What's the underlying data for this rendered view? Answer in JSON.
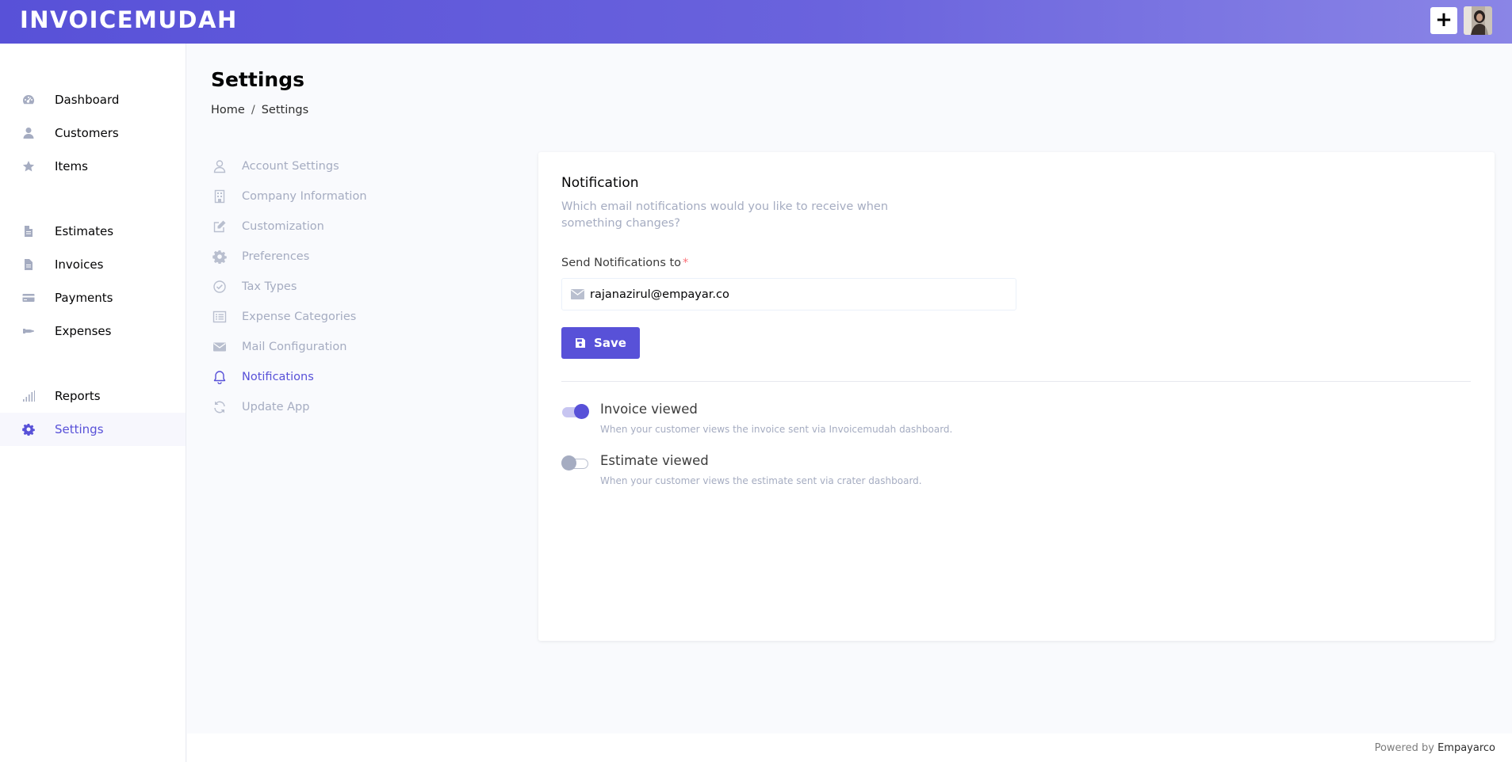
{
  "app": {
    "logo": "INVOICEMUDAH",
    "add_button": "+",
    "colors": {
      "primary": "#5851d8",
      "muted": "#a5acc1",
      "required": "#fb7178"
    }
  },
  "sidebar": {
    "items": [
      {
        "label": "Dashboard",
        "icon": "dashboard-gauge-icon"
      },
      {
        "label": "Customers",
        "icon": "user-icon"
      },
      {
        "label": "Items",
        "icon": "star-icon"
      },
      {
        "label": "Estimates",
        "icon": "document-icon"
      },
      {
        "label": "Invoices",
        "icon": "document-icon"
      },
      {
        "label": "Payments",
        "icon": "credit-card-icon"
      },
      {
        "label": "Expenses",
        "icon": "money-icon"
      },
      {
        "label": "Reports",
        "icon": "signal-bars-icon"
      },
      {
        "label": "Settings",
        "icon": "gear-icon",
        "active": true
      }
    ]
  },
  "page": {
    "title": "Settings",
    "breadcrumb": {
      "home": "Home",
      "separator": "/",
      "current": "Settings"
    }
  },
  "settings_menu": {
    "items": [
      {
        "label": "Account Settings",
        "icon": "user-outline-icon"
      },
      {
        "label": "Company Information",
        "icon": "building-icon"
      },
      {
        "label": "Customization",
        "icon": "edit-icon"
      },
      {
        "label": "Preferences",
        "icon": "gear-icon"
      },
      {
        "label": "Tax Types",
        "icon": "check-circle-icon"
      },
      {
        "label": "Expense Categories",
        "icon": "list-icon"
      },
      {
        "label": "Mail Configuration",
        "icon": "envelope-icon"
      },
      {
        "label": "Notifications",
        "icon": "bell-icon",
        "active": true
      },
      {
        "label": "Update App",
        "icon": "refresh-icon"
      }
    ]
  },
  "notification": {
    "title": "Notification",
    "description": "Which email notifications would you like to receive when something changes?",
    "field_label": "Send Notifications to",
    "required_mark": "*",
    "email_value": "rajanazirul@empayar.co",
    "save_label": "Save",
    "toggles": [
      {
        "title": "Invoice viewed",
        "description": "When your customer views the invoice sent via Invoicemudah dashboard.",
        "on": true
      },
      {
        "title": "Estimate viewed",
        "description": "When your customer views the estimate sent via crater dashboard.",
        "on": false
      }
    ]
  },
  "footer": {
    "prefix": "Powered by",
    "brand": "Empayarco"
  }
}
